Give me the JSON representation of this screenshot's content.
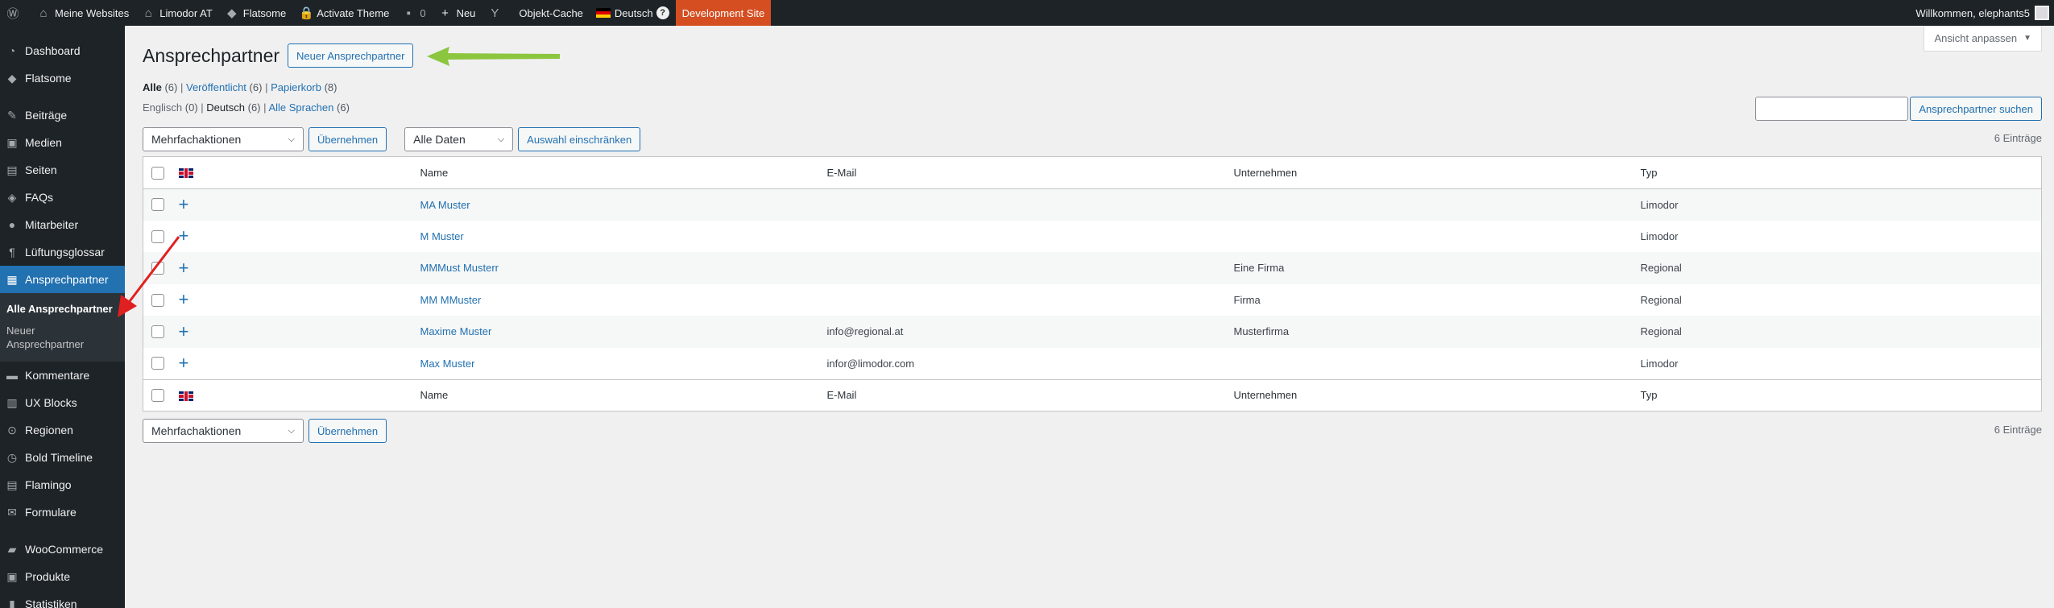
{
  "adminbar": {
    "my_sites": "Meine Websites",
    "site_name": "Limodor AT",
    "flatsome": "Flatsome",
    "activate_theme": "Activate Theme",
    "comments_count": "0",
    "new": "Neu",
    "object_cache": "Objekt-Cache",
    "language": "Deutsch",
    "help": "?",
    "dev_site": "Development Site",
    "welcome": "Willkommen, elephants5"
  },
  "sidebar": {
    "items": [
      {
        "label": "Dashboard",
        "icon": "dashboard-icon"
      },
      {
        "label": "Flatsome",
        "icon": "flatsome-icon"
      },
      {
        "label": "Beiträge",
        "icon": "pin-icon"
      },
      {
        "label": "Medien",
        "icon": "media-icon"
      },
      {
        "label": "Seiten",
        "icon": "pages-icon"
      },
      {
        "label": "FAQs",
        "icon": "tag-icon"
      },
      {
        "label": "Mitarbeiter",
        "icon": "user-icon"
      },
      {
        "label": "Lüftungsglossar",
        "icon": "paragraph-icon"
      },
      {
        "label": "Ansprechpartner",
        "icon": "id-card-icon"
      },
      {
        "label": "Kommentare",
        "icon": "comments-icon"
      },
      {
        "label": "UX Blocks",
        "icon": "blocks-icon"
      },
      {
        "label": "Regionen",
        "icon": "location-icon"
      },
      {
        "label": "Bold Timeline",
        "icon": "timeline-icon"
      },
      {
        "label": "Flamingo",
        "icon": "flamingo-icon"
      },
      {
        "label": "Formulare",
        "icon": "mail-icon"
      },
      {
        "label": "WooCommerce",
        "icon": "woo-icon"
      },
      {
        "label": "Produkte",
        "icon": "products-icon"
      },
      {
        "label": "Statistiken",
        "icon": "stats-icon"
      }
    ],
    "submenu": {
      "all": "Alle Ansprechpartner",
      "new": "Neuer Ansprechpartner"
    }
  },
  "screen_options": "Ansicht anpassen",
  "page": {
    "title": "Ansprechpartner",
    "add_new": "Neuer Ansprechpartner"
  },
  "filters": {
    "all": "Alle",
    "all_count": "(6)",
    "published": "Veröffentlicht",
    "published_count": "(6)",
    "trash": "Papierkorb",
    "trash_count": "(8)",
    "english": "Englisch",
    "english_count": "(0)",
    "german": "Deutsch",
    "german_count": "(6)",
    "all_languages": "Alle Sprachen",
    "all_languages_count": "(6)"
  },
  "search": {
    "button": "Ansprechpartner suchen"
  },
  "tablenav": {
    "bulk_actions": "Mehrfachaktionen",
    "apply": "Übernehmen",
    "all_dates": "Alle Daten",
    "filter": "Auswahl einschränken",
    "count": "6 Einträge"
  },
  "table": {
    "columns": [
      "Name",
      "E-Mail",
      "Unternehmen",
      "Typ"
    ],
    "rows": [
      {
        "name": "MA Muster",
        "email": "",
        "company": "",
        "type": "Limodor"
      },
      {
        "name": "M Muster",
        "email": "",
        "company": "",
        "type": "Limodor"
      },
      {
        "name": "MMMust Musterr",
        "email": "",
        "company": "Eine Firma",
        "type": "Regional"
      },
      {
        "name": "MM MMuster",
        "email": "",
        "company": "Firma",
        "type": "Regional"
      },
      {
        "name": "Maxime Muster",
        "email": "info@regional.at",
        "company": "Musterfirma",
        "type": "Regional"
      },
      {
        "name": "Max Muster",
        "email": "infor@limodor.com",
        "company": "",
        "type": "Limodor"
      }
    ]
  },
  "colors": {
    "admin_bg": "#1d2327",
    "accent": "#2271b1",
    "dev_site": "#d54e21",
    "arrow_green": "#8cc63f",
    "arrow_red": "#e02020"
  }
}
